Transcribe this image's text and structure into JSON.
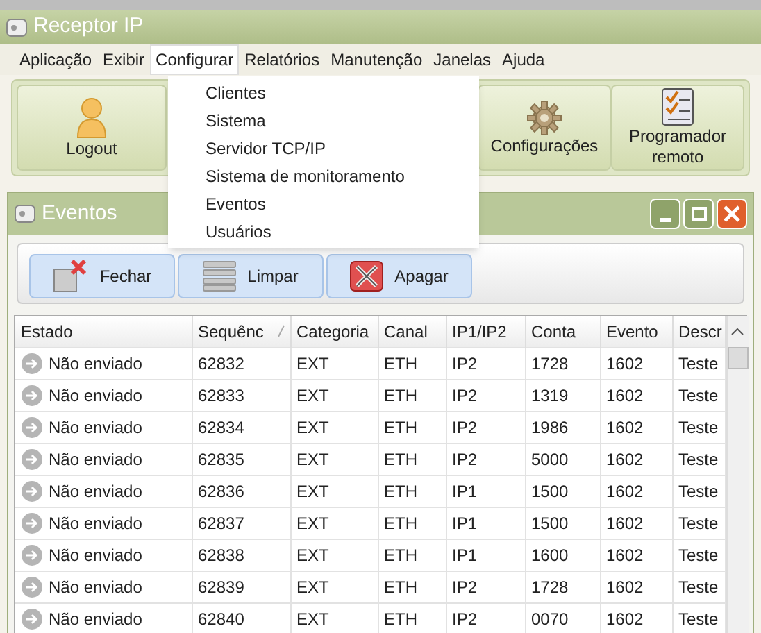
{
  "window": {
    "title": "Receptor IP"
  },
  "menu_bar": [
    {
      "label": "Aplicação",
      "open": false
    },
    {
      "label": "Exibir",
      "open": false
    },
    {
      "label": "Configurar",
      "open": true
    },
    {
      "label": "Relatórios",
      "open": false
    },
    {
      "label": "Manutenção",
      "open": false
    },
    {
      "label": "Janelas",
      "open": false
    },
    {
      "label": "Ajuda",
      "open": false
    }
  ],
  "toolbar": [
    {
      "kind": "user",
      "label": "Logout"
    },
    {
      "kind": "gear",
      "label": "Configurações"
    },
    {
      "kind": "checklist",
      "label": "Programador remoto"
    }
  ],
  "dropdown": [
    "Clientes",
    "Sistema",
    "Servidor TCP/IP",
    "Sistema de monitoramento",
    "Eventos",
    "Usuários"
  ],
  "child_window": {
    "title": "Eventos",
    "toolbar": [
      {
        "kind": "close",
        "label": "Fechar"
      },
      {
        "kind": "clear",
        "label": "Limpar"
      },
      {
        "kind": "delete",
        "label": "Apagar"
      }
    ],
    "table": {
      "columns": [
        "Estado",
        "Sequênc",
        "Categoria",
        "Canal",
        "IP1/IP2",
        "Conta",
        "Evento",
        "Descr"
      ],
      "rows": [
        [
          "Não enviado",
          "62832",
          "EXT",
          "ETH",
          "IP2",
          "1728",
          "1602",
          "Teste"
        ],
        [
          "Não enviado",
          "62833",
          "EXT",
          "ETH",
          "IP2",
          "1319",
          "1602",
          "Teste"
        ],
        [
          "Não enviado",
          "62834",
          "EXT",
          "ETH",
          "IP2",
          "1986",
          "1602",
          "Teste"
        ],
        [
          "Não enviado",
          "62835",
          "EXT",
          "ETH",
          "IP2",
          "5000",
          "1602",
          "Teste"
        ],
        [
          "Não enviado",
          "62836",
          "EXT",
          "ETH",
          "IP1",
          "1500",
          "1602",
          "Teste"
        ],
        [
          "Não enviado",
          "62837",
          "EXT",
          "ETH",
          "IP1",
          "1500",
          "1602",
          "Teste"
        ],
        [
          "Não enviado",
          "62838",
          "EXT",
          "ETH",
          "IP1",
          "1600",
          "1602",
          "Teste"
        ],
        [
          "Não enviado",
          "62839",
          "EXT",
          "ETH",
          "IP2",
          "1728",
          "1602",
          "Teste"
        ],
        [
          "Não enviado",
          "62840",
          "EXT",
          "ETH",
          "IP2",
          "0070",
          "1602",
          "Teste"
        ]
      ]
    }
  }
}
